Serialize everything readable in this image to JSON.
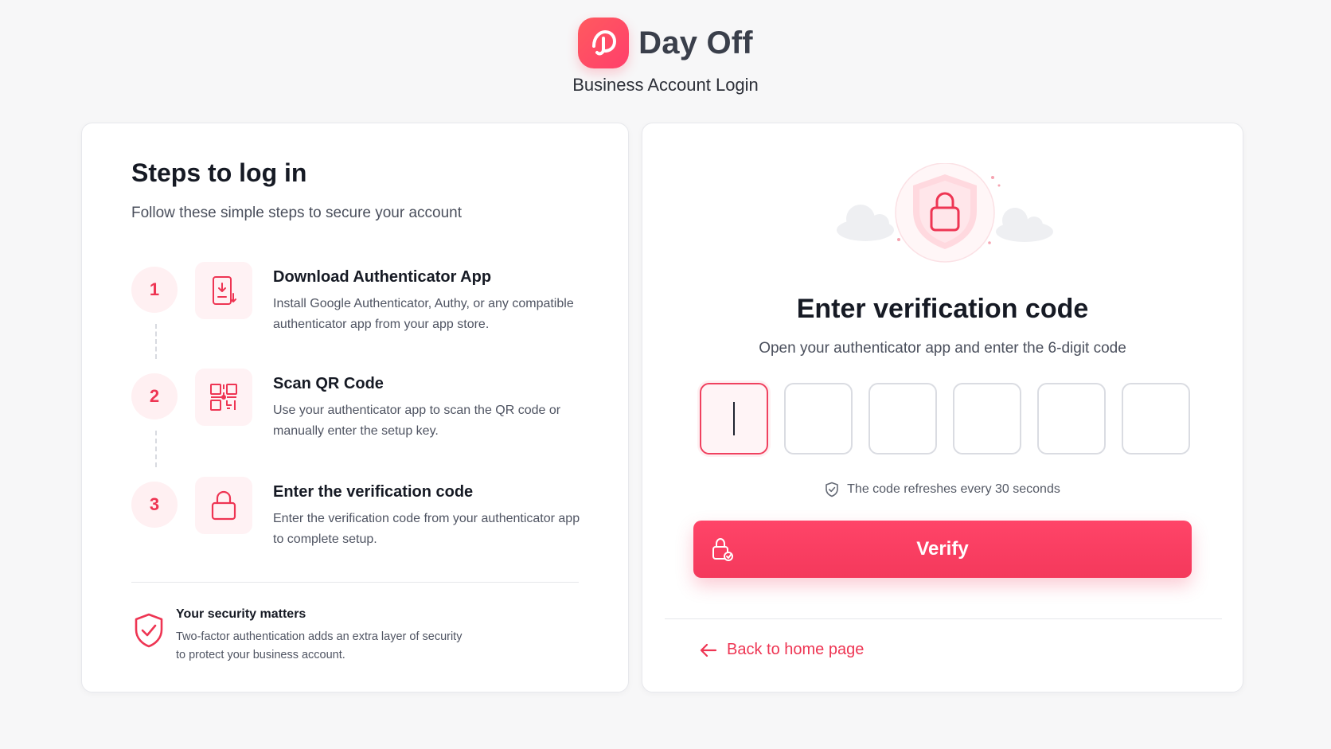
{
  "brand": {
    "name": "Day Off",
    "subtitle": "Business Account Login",
    "accent": "#f0415f"
  },
  "steps_panel": {
    "title": "Steps to log in",
    "subtitle": "Follow these simple steps to secure your account",
    "steps": [
      {
        "number": "1",
        "icon": "download-icon",
        "title": "Download Authenticator App",
        "description": "Install Google Authenticator, Authy, or any compatible authenticator app from your app store."
      },
      {
        "number": "2",
        "icon": "qr-code-icon",
        "title": "Scan QR Code",
        "description": "Use your authenticator app to scan the QR code or manually enter the setup key."
      },
      {
        "number": "3",
        "icon": "lock-icon",
        "title": "Enter the verification code",
        "description": "Enter the verification code from your authenticator app to complete setup."
      }
    ],
    "security": {
      "icon": "shield-check-icon",
      "title": "Your security matters",
      "description": "Two-factor authentication adds an extra layer of security to protect your business account."
    }
  },
  "verify_panel": {
    "illustration": "shield-lock-icon",
    "title": "Enter verification code",
    "subtitle": "Open your authenticator app and enter the 6-digit code",
    "code_digits": [
      "",
      "",
      "",
      "",
      "",
      ""
    ],
    "active_digit_index": 0,
    "refresh_note": "The code refreshes every 30 seconds",
    "verify_label": "Verify",
    "back_label": "Back to home page"
  }
}
